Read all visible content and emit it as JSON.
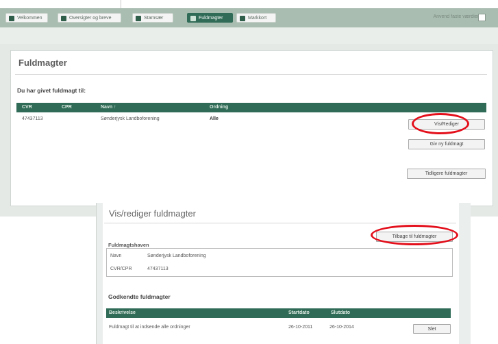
{
  "nav": {
    "tabs": [
      {
        "label": "Velkommen",
        "active": false
      },
      {
        "label": "Oversigter og breve",
        "active": false
      },
      {
        "label": "Stamsær",
        "active": false
      },
      {
        "label": "Fuldmagter",
        "active": true
      },
      {
        "label": "Markkort",
        "active": false
      }
    ],
    "right_label": "Anvend faste værdier"
  },
  "fuldmagter": {
    "title": "Fuldmagter",
    "subtitle": "Du har givet fuldmagt til:",
    "columns": [
      "CVR",
      "CPR",
      "Navn ↑",
      "Ordning"
    ],
    "rows": [
      {
        "cvr": "47437113",
        "navn": "Sønderjysk Landboforening",
        "ordning": "Alle"
      }
    ],
    "btn_vis": "Vis/Rediger",
    "btn_giv": "Giv ny fuldmagt",
    "btn_tidligere": "Tidligere fuldmagter"
  },
  "vis_rediger": {
    "title": "Vis/rediger fuldmagter",
    "btn_tilbage": "Tilbage til fuldmagter",
    "group_label": "Fuldmagtshaven",
    "fields": [
      {
        "label": "Navn",
        "value": "Sønderjysk Landboforening"
      },
      {
        "label": "CVR/CPR",
        "value": "47437113"
      }
    ],
    "approved_title": "Godkendte fuldmagter",
    "columns": [
      "Beskrivelse",
      "Startdato",
      "Slutdato"
    ],
    "rows": [
      {
        "beskrivelse": "Fuldmagt til at indsende alle ordninger",
        "start": "26-10-2011",
        "slut": "26-10-2014"
      }
    ],
    "btn_slet": "Slet"
  },
  "colors": {
    "header_green": "#2f6b56",
    "nav_green": "#a9bdb0",
    "highlight_red": "#e3101c"
  }
}
